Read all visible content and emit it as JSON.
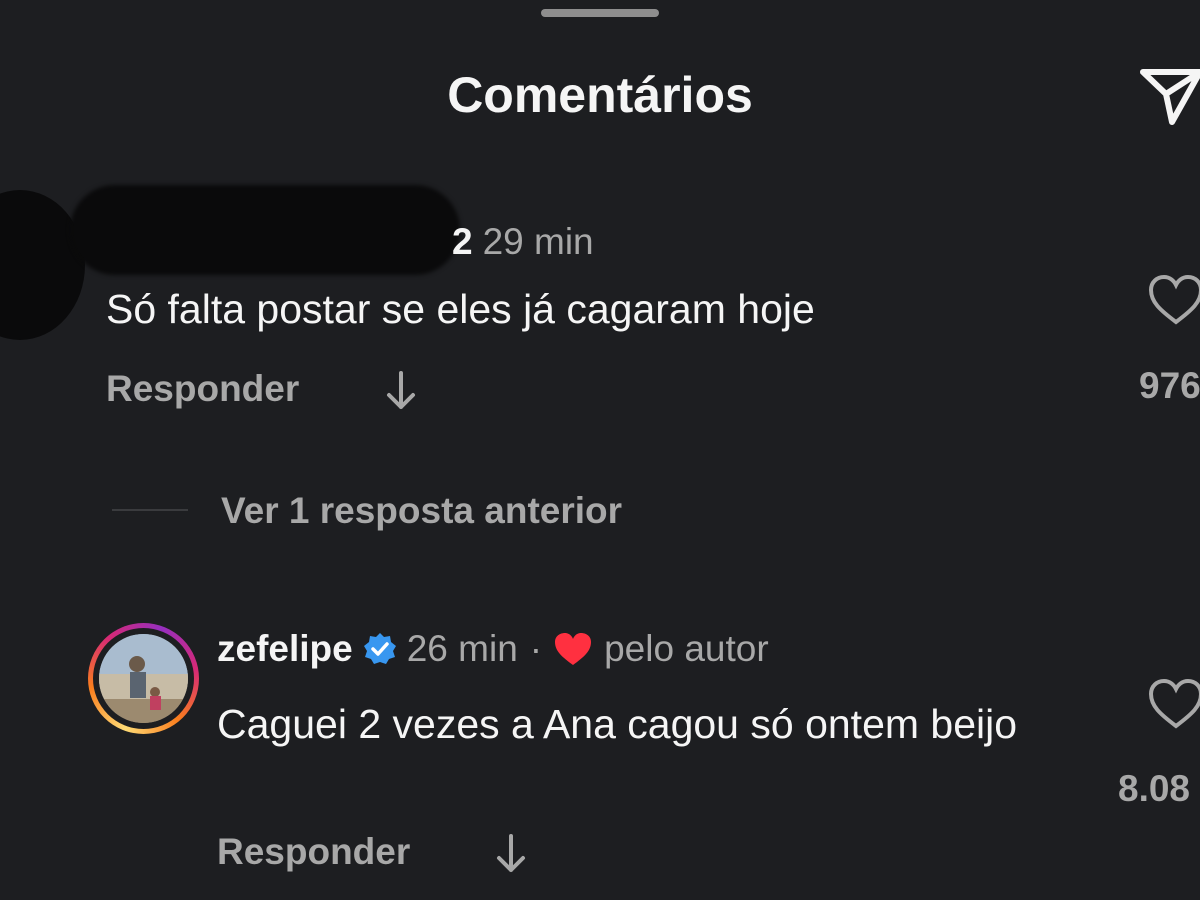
{
  "header": {
    "title": "Comentários",
    "share_icon": "send-icon"
  },
  "comments": [
    {
      "username_suffix": "2",
      "time": "29 min",
      "text": "Só falta postar se eles já cagaram hoje",
      "reply_label": "Responder",
      "likes": "976"
    },
    {
      "username": "zefelipe",
      "verified": true,
      "time": "26 min",
      "separator": "·",
      "liked_by_author_label": "pelo autor",
      "text": "Caguei 2 vezes a Ana cagou só ontem beijo",
      "reply_label": "Responder",
      "likes": "8.08"
    }
  ],
  "thread": {
    "view_previous_label": "Ver 1 resposta anterior"
  },
  "colors": {
    "background": "#1d1e21",
    "primary_text": "#f5f5f5",
    "secondary_text": "#a8a8a8",
    "verified_blue": "#3897f0",
    "author_heart": "#ff3040"
  }
}
